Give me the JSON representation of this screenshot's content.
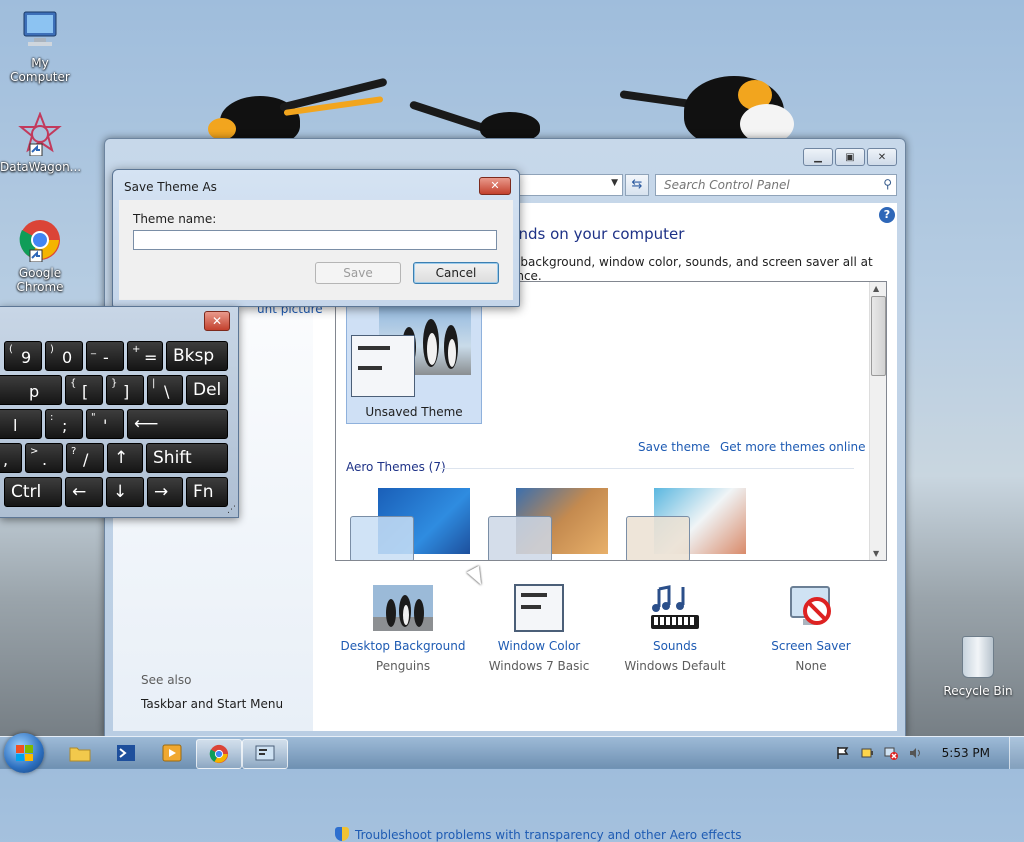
{
  "desktop": {
    "icons": [
      {
        "label": "My Computer"
      },
      {
        "label": "DataWagon..."
      },
      {
        "label": "Google Chrome"
      },
      {
        "label": "Recycle Bin"
      }
    ]
  },
  "control_panel": {
    "search_placeholder": "Search Control Panel",
    "heading": "unds on your computer",
    "description": "p background, window color, sounds, and screen saver all at once.",
    "account_picture_link": "unt picture",
    "see_also": "See also",
    "taskbar_link": "Taskbar and Start Menu",
    "my_themes": {
      "selected_label": "Unsaved Theme",
      "save_theme": "Save theme",
      "get_more": "Get more themes online"
    },
    "aero_themes_header": "Aero Themes (7)",
    "categories": [
      {
        "name": "Desktop Background",
        "value": "Penguins"
      },
      {
        "name": "Window Color",
        "value": "Windows 7 Basic"
      },
      {
        "name": "Sounds",
        "value": "Windows Default"
      },
      {
        "name": "Screen Saver",
        "value": "None"
      }
    ],
    "troubleshoot": "Troubleshoot problems with transparency and other Aero effects"
  },
  "dialog": {
    "title": "Save Theme As",
    "label": "Theme name:",
    "input_value": "",
    "save_label": "Save",
    "cancel_label": "Cancel"
  },
  "keyboard": {
    "rows": [
      [
        {
          "top": "(",
          "main": "9"
        },
        {
          "top": ")",
          "main": "0"
        },
        {
          "top": "_",
          "main": "-"
        },
        {
          "top": "+",
          "main": "="
        },
        {
          "word": "Bksp"
        }
      ],
      [
        {
          "main": "p"
        },
        {
          "top": "{",
          "main": "["
        },
        {
          "top": "}",
          "main": "]"
        },
        {
          "top": "|",
          "main": "\\"
        },
        {
          "word": "Del"
        }
      ],
      [
        {
          "main": "l"
        },
        {
          "top": ":",
          "main": ";"
        },
        {
          "top": "\"",
          "main": "'"
        },
        {
          "word": "⟵"
        }
      ],
      [
        {
          "main": ","
        },
        {
          "top": ">",
          "main": "."
        },
        {
          "top": "?",
          "main": "/"
        },
        {
          "word": "↑"
        },
        {
          "word": "Shift"
        }
      ],
      [
        {
          "word": "Ctrl"
        },
        {
          "word": "←"
        },
        {
          "word": "↓"
        },
        {
          "word": "→"
        },
        {
          "word": "Fn"
        }
      ]
    ]
  },
  "taskbar": {
    "clock": "5:53 PM"
  },
  "colors": {
    "link": "#1e5bb3",
    "heading": "#1e3287",
    "close_red": "#c3412d"
  }
}
